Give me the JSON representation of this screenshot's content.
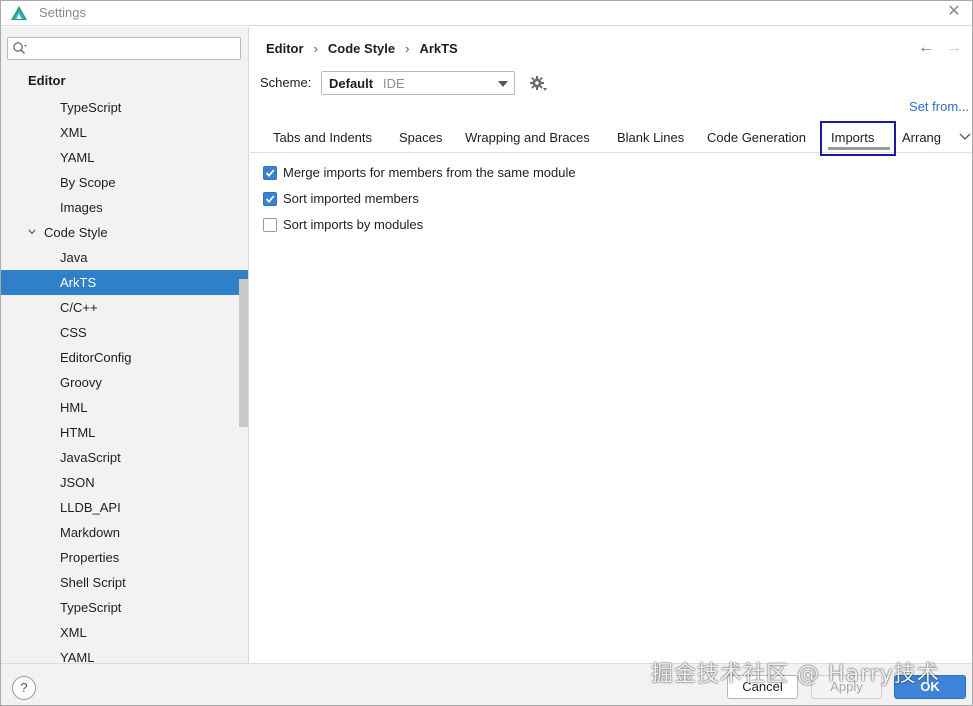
{
  "window": {
    "title": "Settings"
  },
  "sidebar": {
    "search": {
      "value": "",
      "placeholder": ""
    },
    "items": [
      {
        "label": "Editor",
        "level": 0
      },
      {
        "label": "TypeScript",
        "level": 2
      },
      {
        "label": "XML",
        "level": 2
      },
      {
        "label": "YAML",
        "level": 2
      },
      {
        "label": "By Scope",
        "level": 2
      },
      {
        "label": "Images",
        "level": 2
      },
      {
        "label": "Code Style",
        "level": 1,
        "expanded": true
      },
      {
        "label": "Java",
        "level": 2
      },
      {
        "label": "ArkTS",
        "level": 2,
        "selected": true
      },
      {
        "label": "C/C++",
        "level": 2
      },
      {
        "label": "CSS",
        "level": 2
      },
      {
        "label": "EditorConfig",
        "level": 2
      },
      {
        "label": "Groovy",
        "level": 2
      },
      {
        "label": "HML",
        "level": 2
      },
      {
        "label": "HTML",
        "level": 2
      },
      {
        "label": "JavaScript",
        "level": 2
      },
      {
        "label": "JSON",
        "level": 2
      },
      {
        "label": "LLDB_API",
        "level": 2
      },
      {
        "label": "Markdown",
        "level": 2
      },
      {
        "label": "Properties",
        "level": 2
      },
      {
        "label": "Shell Script",
        "level": 2
      },
      {
        "label": "TypeScript",
        "level": 2
      },
      {
        "label": "XML",
        "level": 2
      },
      {
        "label": "YAML",
        "level": 2
      }
    ]
  },
  "breadcrumb": [
    "Editor",
    "Code Style",
    "ArkTS"
  ],
  "scheme": {
    "label": "Scheme:",
    "name": "Default",
    "sub": "IDE"
  },
  "set_from": "Set from...",
  "tabs": [
    {
      "label": "Tabs and Indents"
    },
    {
      "label": "Spaces"
    },
    {
      "label": "Wrapping and Braces"
    },
    {
      "label": "Blank Lines"
    },
    {
      "label": "Code Generation"
    },
    {
      "label": "Imports",
      "active": true
    },
    {
      "label": "Arrang"
    }
  ],
  "options": [
    {
      "label": "Merge imports for members from the same module",
      "checked": true
    },
    {
      "label": "Sort imported members",
      "checked": true
    },
    {
      "label": "Sort imports by modules",
      "checked": false
    }
  ],
  "footer": {
    "help": "?",
    "cancel": "Cancel",
    "apply": "Apply",
    "ok": "OK"
  },
  "watermark": "掘金技术社区 @ Harry技术",
  "colors": {
    "selection": "#2f7fc9",
    "ok_button": "#3d84d8",
    "link": "#2c70c6",
    "highlight_box": "#1a1aa8"
  }
}
